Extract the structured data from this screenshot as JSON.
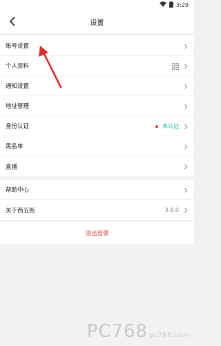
{
  "status_bar": {
    "time": "3:29"
  },
  "nav": {
    "title": "设置"
  },
  "groups": [
    {
      "items": [
        {
          "label": "账号设置"
        },
        {
          "label": "个人资料"
        },
        {
          "label": "通知设置"
        },
        {
          "label": "地址管理"
        },
        {
          "label": "身份认证",
          "status": "未认证"
        },
        {
          "label": "黑名单"
        },
        {
          "label": "直播"
        }
      ]
    },
    {
      "items": [
        {
          "label": "帮助中心"
        },
        {
          "label": "关于西五街",
          "value": "3.8.0"
        }
      ]
    }
  ],
  "logout": {
    "label": "退出登录"
  },
  "watermark": {
    "main": "PC768",
    "sub": "pc768.com"
  },
  "colors": {
    "accent_teal": "#19b6b0",
    "danger_red": "#e23d3d",
    "annotation_arrow": "#e02a2a"
  }
}
